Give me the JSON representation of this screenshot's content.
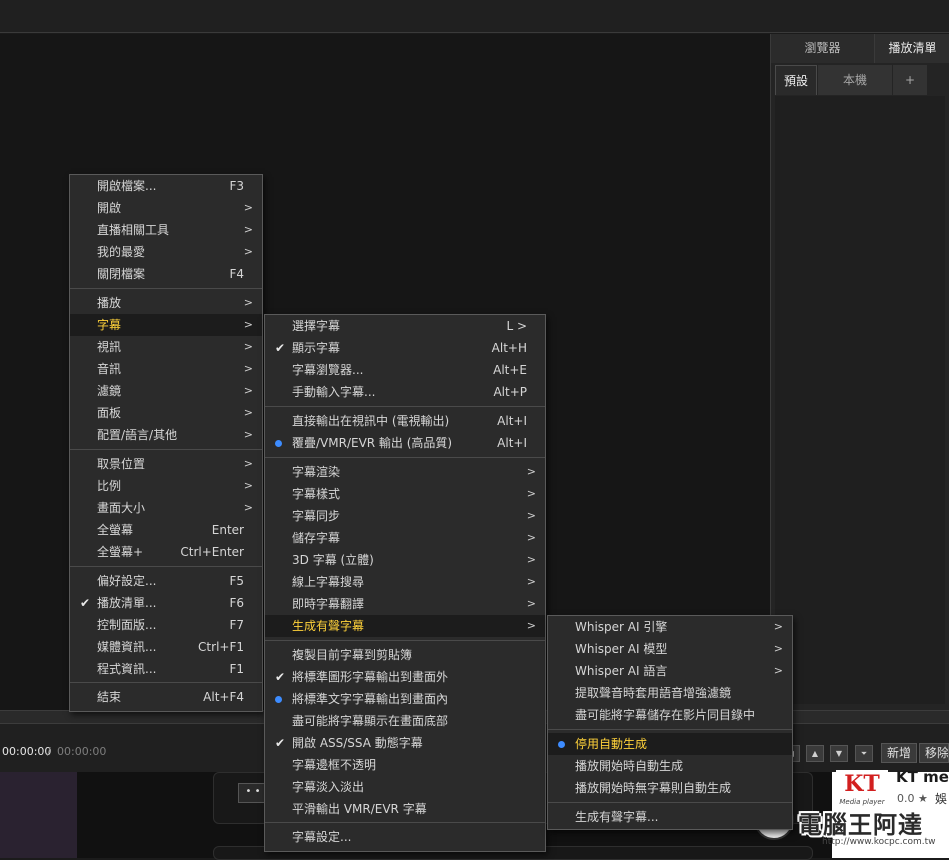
{
  "side_panel": {
    "tabs": [
      "瀏覽器",
      "播放清單"
    ],
    "subtabs": [
      "預設",
      "本機",
      "+"
    ]
  },
  "controls": {
    "time_current": "00:00:00",
    "time_sep": "/",
    "time_total": "00:00:00",
    "nav_buttons": [
      "◀",
      "▲",
      "▼",
      "⏷"
    ],
    "new_label": "新增",
    "remove_label": "移除"
  },
  "bottom_card": {
    "dots": "• •",
    "app_name": "KT media",
    "rating": "0.0 ★",
    "category": "娛",
    "logo_text": "KT",
    "logo_caption": "Media player"
  },
  "watermark": {
    "text": "電腦王阿達",
    "url": "http://www.kocpc.com.tw"
  },
  "main_menu": {
    "items": [
      {
        "label": "開啟檔案...",
        "accel": "F3"
      },
      {
        "label": "開啟",
        "arrow": true
      },
      {
        "label": "直播相關工具",
        "arrow": true
      },
      {
        "label": "我的最愛",
        "arrow": true
      },
      {
        "label": "關閉檔案",
        "accel": "F4"
      },
      {
        "label": "播放",
        "arrow": true
      },
      {
        "label": "字幕",
        "arrow": true,
        "highlighted": true
      },
      {
        "label": "視訊",
        "arrow": true
      },
      {
        "label": "音訊",
        "arrow": true
      },
      {
        "label": "濾鏡",
        "arrow": true
      },
      {
        "label": "面板",
        "arrow": true
      },
      {
        "label": "配置/語言/其他",
        "arrow": true
      },
      {
        "label": "取景位置",
        "arrow": true
      },
      {
        "label": "比例",
        "arrow": true
      },
      {
        "label": "畫面大小",
        "arrow": true
      },
      {
        "label": "全螢幕",
        "accel": "Enter"
      },
      {
        "label": "全螢幕+",
        "accel": "Ctrl+Enter"
      },
      {
        "label": "偏好設定...",
        "accel": "F5"
      },
      {
        "label": "播放清單...",
        "accel": "F6",
        "checked": true
      },
      {
        "label": "控制面版...",
        "accel": "F7"
      },
      {
        "label": "媒體資訊...",
        "accel": "Ctrl+F1"
      },
      {
        "label": "程式資訊...",
        "accel": "F1"
      },
      {
        "label": "結束",
        "accel": "Alt+F4"
      }
    ]
  },
  "subtitle_menu": {
    "items": [
      {
        "label": "選擇字幕",
        "accel": "L >"
      },
      {
        "label": "顯示字幕",
        "accel": "Alt+H",
        "checked": true
      },
      {
        "label": "字幕瀏覽器...",
        "accel": "Alt+E"
      },
      {
        "label": "手動輸入字幕...",
        "accel": "Alt+P"
      },
      {
        "label": "直接輸出在視訊中 (電視輸出)",
        "accel": "Alt+I"
      },
      {
        "label": "覆疊/VMR/EVR 輸出 (高品質)",
        "accel": "Alt+I",
        "radio": true
      },
      {
        "label": "字幕渲染",
        "arrow": true
      },
      {
        "label": "字幕樣式",
        "arrow": true
      },
      {
        "label": "字幕同步",
        "arrow": true
      },
      {
        "label": "儲存字幕",
        "arrow": true
      },
      {
        "label": "3D 字幕 (立體)",
        "arrow": true
      },
      {
        "label": "線上字幕搜尋",
        "arrow": true
      },
      {
        "label": "即時字幕翻譯",
        "arrow": true
      },
      {
        "label": "生成有聲字幕",
        "arrow": true,
        "highlighted": true
      },
      {
        "label": "複製目前字幕到剪貼簿"
      },
      {
        "label": "將標準圖形字幕輸出到畫面外",
        "checked": true
      },
      {
        "label": "將標準文字字幕輸出到畫面內",
        "radio": true
      },
      {
        "label": "盡可能將字幕顯示在畫面底部"
      },
      {
        "label": "開啟 ASS/SSA 動態字幕",
        "checked": true
      },
      {
        "label": "字幕邊框不透明"
      },
      {
        "label": "字幕淡入淡出"
      },
      {
        "label": "平滑輸出 VMR/EVR 字幕"
      },
      {
        "label": "字幕設定..."
      }
    ]
  },
  "generate_menu": {
    "items": [
      {
        "label": "Whisper AI 引擎",
        "arrow": true
      },
      {
        "label": "Whisper AI 模型",
        "arrow": true
      },
      {
        "label": "Whisper AI 語言",
        "arrow": true
      },
      {
        "label": "提取聲音時套用語音增強濾鏡"
      },
      {
        "label": "盡可能將字幕儲存在影片同目錄中"
      },
      {
        "label": "停用自動生成",
        "radio": true,
        "highlighted": true
      },
      {
        "label": "播放開始時自動生成"
      },
      {
        "label": "播放開始時無字幕則自動生成"
      },
      {
        "label": "生成有聲字幕..."
      }
    ]
  }
}
